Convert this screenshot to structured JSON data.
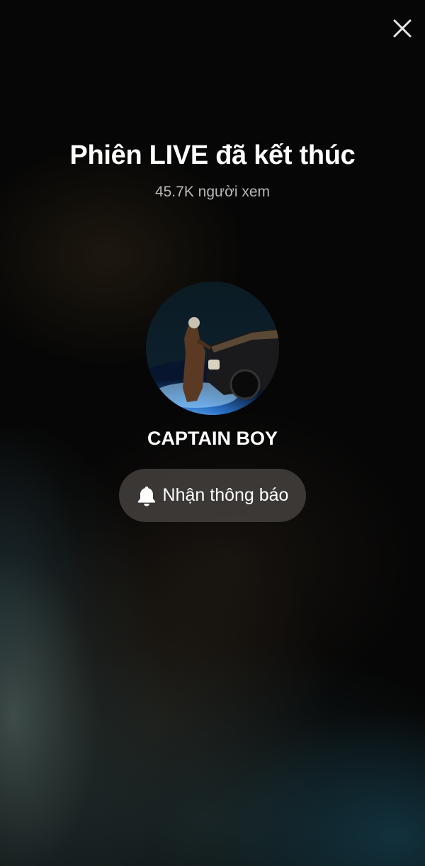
{
  "screen": {
    "title": "Phiên LIVE đã kết thúc",
    "viewer_count": "45.7K người xem"
  },
  "host": {
    "name": "CAPTAIN BOY",
    "avatar_icon": "profile-photo"
  },
  "actions": {
    "notify_label": "Nhận thông báo",
    "notify_icon": "bell-icon",
    "close_icon": "close-icon"
  },
  "colors": {
    "text_primary": "#ffffff",
    "text_secondary": "#b9b9b9",
    "button_bg": "#4e4a46"
  }
}
